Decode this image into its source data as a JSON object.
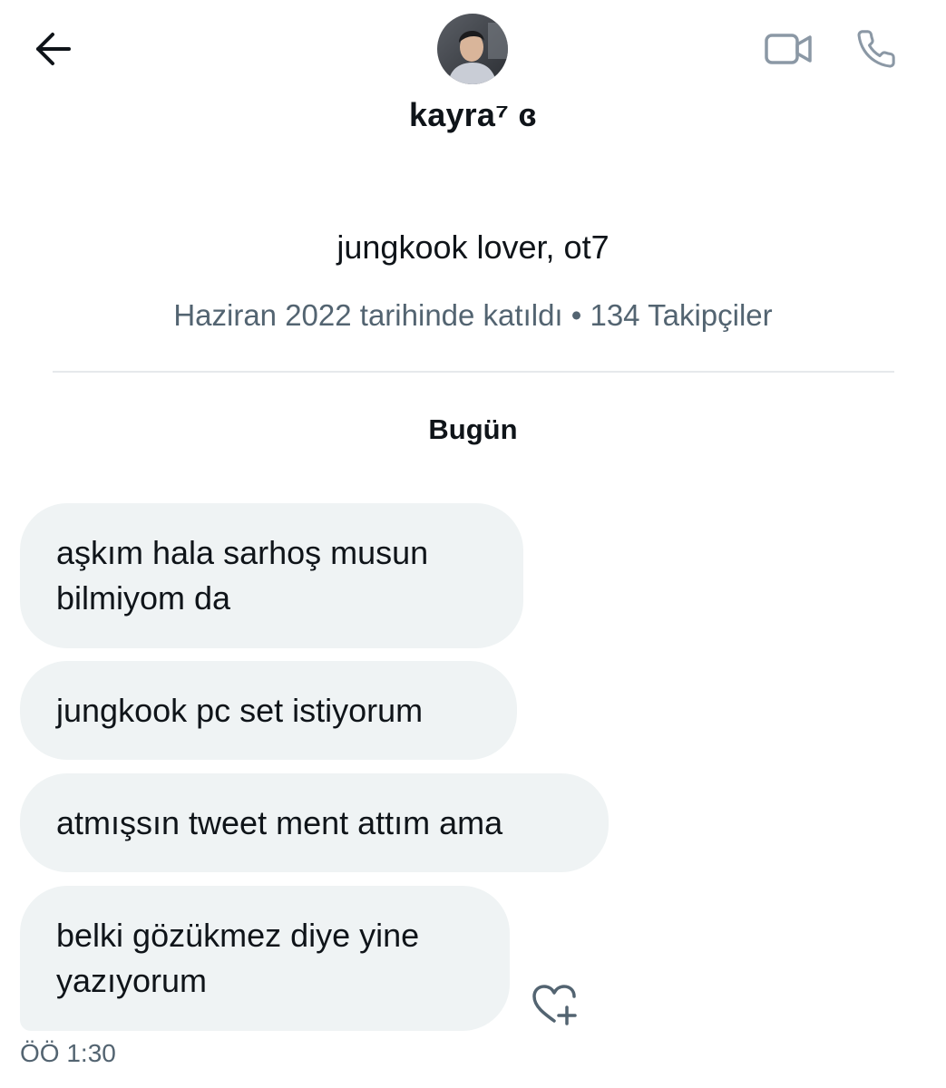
{
  "header": {
    "back_icon": "arrow-left-icon",
    "video_icon": "video-camera-icon",
    "call_icon": "phone-icon",
    "display_name": "kayra⁷ ɞ"
  },
  "profile": {
    "bio": "jungkook lover, ot7",
    "meta": "Haziran 2022 tarihinde katıldı • 134 Takipçiler"
  },
  "conversation": {
    "date_separator": "Bugün",
    "messages": [
      {
        "text": "aşkım hala sarhoş musun\nbilmiyom da"
      },
      {
        "text": "jungkook pc set istiyorum"
      },
      {
        "text": "atmışsın tweet ment attım ama"
      },
      {
        "text": "belki gözükmez diye yine\nyazıyorum"
      }
    ],
    "reaction_icon": "heart-plus-icon",
    "timestamp": "ÖÖ 1:30"
  },
  "colors": {
    "bubble_bg": "#eff3f4",
    "text_primary": "#0f1419",
    "text_secondary": "#536471",
    "icon_gray": "#8b98a5",
    "divider": "#e6e9ec"
  }
}
